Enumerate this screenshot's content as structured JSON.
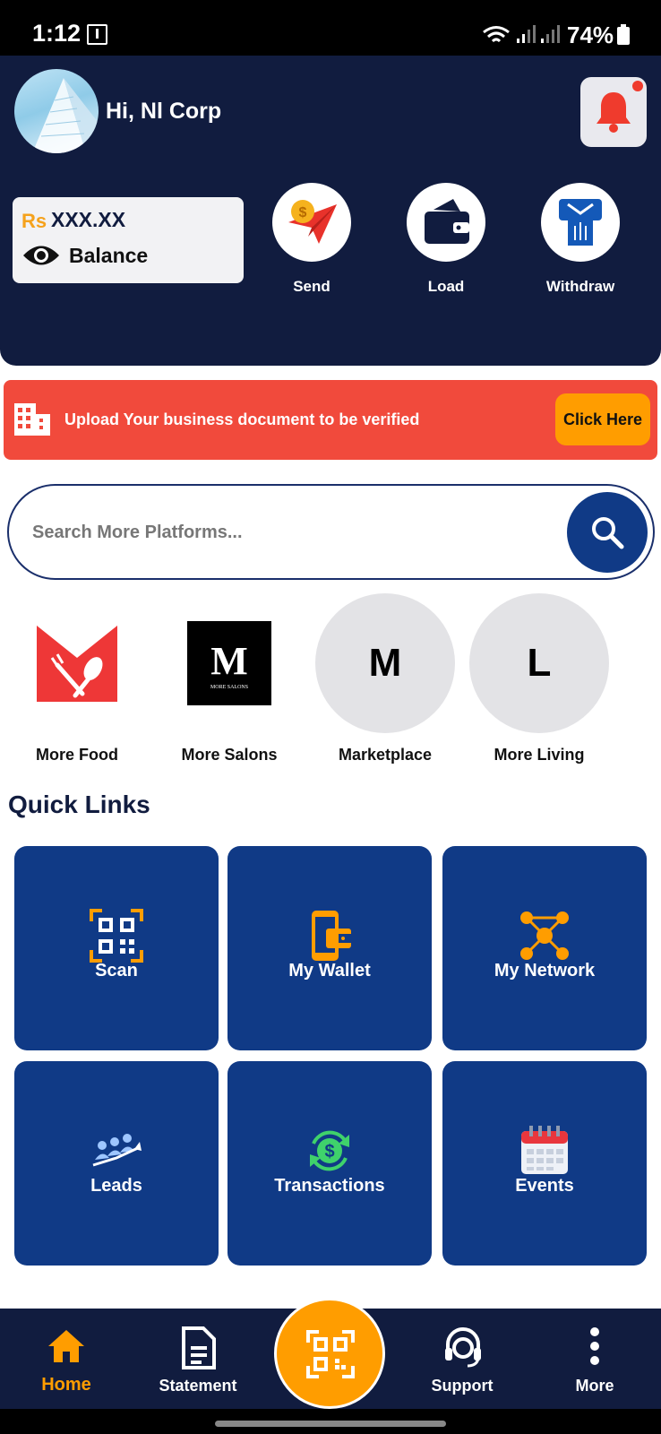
{
  "status_bar": {
    "time": "1:12",
    "battery": "74%"
  },
  "header": {
    "greeting": "Hi, Nl Corp",
    "balance": {
      "currency": "Rs",
      "amount": "XXX.XX",
      "label": "Balance"
    },
    "actions": [
      {
        "label": "Send",
        "icon": "send-money-icon"
      },
      {
        "label": "Load",
        "icon": "wallet-icon"
      },
      {
        "label": "Withdraw",
        "icon": "atm-withdraw-icon"
      }
    ]
  },
  "verify_banner": {
    "text": "Upload Your business document to be verified",
    "button": "Click Here"
  },
  "search": {
    "placeholder": "Search More Platforms..."
  },
  "platforms": [
    {
      "label": "More Food",
      "logo": "M"
    },
    {
      "label": "More Salons",
      "logo": "M",
      "logo_caption": "MORE SALONS"
    },
    {
      "label": "Marketplace",
      "logo": "M"
    },
    {
      "label": "More Living",
      "logo": "L"
    }
  ],
  "quick_links": {
    "title": "Quick Links",
    "items": [
      {
        "label": "Scan",
        "icon": "qr-scan-icon"
      },
      {
        "label": "My Wallet",
        "icon": "mobile-wallet-icon"
      },
      {
        "label": "My Network",
        "icon": "network-icon"
      },
      {
        "label": "Leads",
        "icon": "leads-icon"
      },
      {
        "label": "Transactions",
        "icon": "transactions-icon"
      },
      {
        "label": "Events",
        "icon": "calendar-icon"
      }
    ]
  },
  "bottom_nav": {
    "items": [
      {
        "label": "Home",
        "active": true
      },
      {
        "label": "Statement"
      },
      {
        "label": "Support"
      },
      {
        "label": "More"
      }
    ]
  },
  "colors": {
    "header_bg": "#111c3f",
    "accent": "#ff9d00",
    "banner": "#f14a3c",
    "tile": "#103a86"
  }
}
